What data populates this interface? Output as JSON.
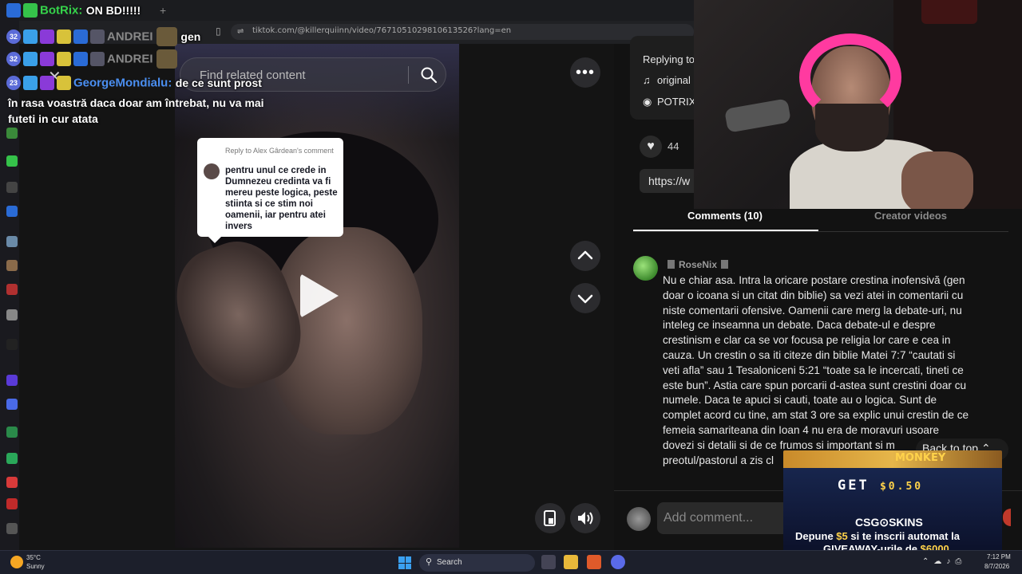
{
  "browser": {
    "url": "tiktok.com/@killerquiinn/video/7671051029810613526?lang=en"
  },
  "video": {
    "search_placeholder": "Find related content",
    "reply_header": "Reply to Alex Gârdean's comment",
    "reply_text": "pentru unul ce crede in Dumnezeu credinta va fi mereu peste logica, peste stiinta si ce stim noi oamenii, iar pentru atei invers"
  },
  "panel": {
    "replying_to": "Replying to",
    "sound": "original",
    "account": "POTRIX",
    "likes": "44",
    "link": "https://w",
    "tabs": [
      {
        "label": "Comments (10)",
        "active": true
      },
      {
        "label": "Creator videos",
        "active": false
      }
    ],
    "comment": {
      "username": "RoseNix",
      "text": "Nu e chiar asa. Intra la oricare postare crestina inofensivă (gen doar o icoana si un citat din biblie) sa vezi atei in comentarii cu niste comentarii ofensive. Oamenii care merg la debate-uri, nu inteleg ce inseamna un debate. Daca debate-ul e despre crestinism e clar ca se vor focusa pe religia lor care e cea in cauza. Un crestin o sa iti citeze din biblie Matei 7:7 “cautati si veti afla” sau 1 Tesaloniceni 5:21 “toate sa le incercati, tineti ce este bun”. Astia care spun porcarii d-astea sunt crestini doar cu numele. Daca te apuci si cauti, toate au o logica. Sunt de complet acord cu tine, am stat 3 ore sa explic unui crestin de ce femeia samariteana din Ioan 4 nu era de moravuri usoare dovezi si detalii si de ce frumos si important si m preotul/pastorul a zis cl"
    },
    "back_to_top": "Back to top",
    "add_comment_placeholder": "Add comment..."
  },
  "chat": {
    "line1": {
      "name": "BotRix:",
      "message": "ON BD!!!!!"
    },
    "line2": {
      "badge_num": "32",
      "name": "ANDREI",
      "message": "gen"
    },
    "line3": {
      "badge_num": "32",
      "name": "ANDREI"
    },
    "line4": {
      "badge_num": "23",
      "name": "GeorgeMondialu:",
      "message": "de ce sunt prost"
    },
    "line4_wrap": "în rasa voastră daca doar am întrebat, nu va mai futeti in cur atata",
    "name_colors": {
      "botrix": "#35d24a",
      "george": "#4a8ef0"
    }
  },
  "ad": {
    "top_text": "MONKEY",
    "get": "GET",
    "amount": "$0.50",
    "brand": "CSG⊙SKINS",
    "line1_a": "Depune ",
    "line1_amount": "$5",
    "line1_b": " si te inscrii automat la",
    "line2_a": "GIVEAWAY-urile de ",
    "line2_amount": "$6000"
  },
  "taskbar": {
    "temp": "35°C",
    "condition": "Sunny",
    "search": "Search",
    "time": "7:12 PM",
    "date": "8/7/2026"
  }
}
